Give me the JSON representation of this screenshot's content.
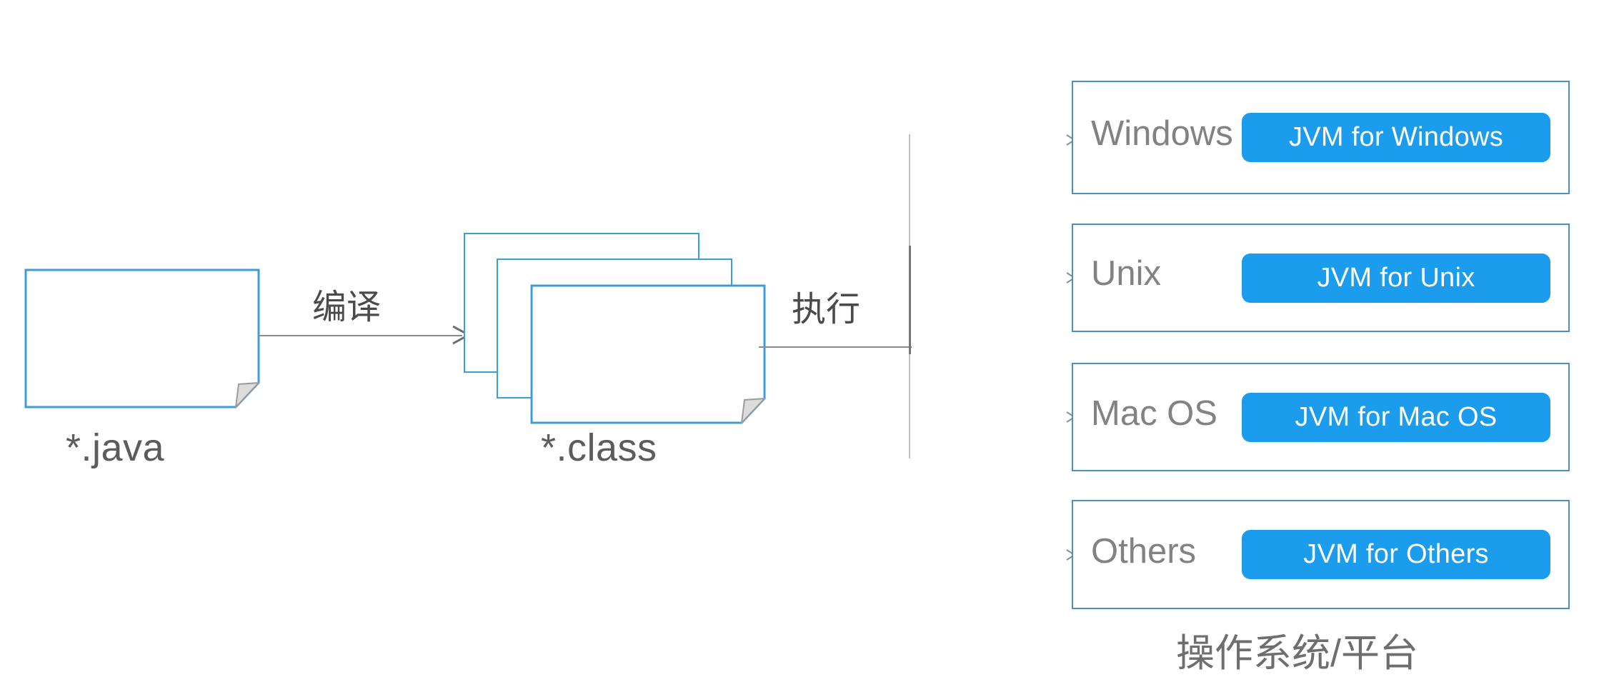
{
  "diagram": {
    "title": "Java compile and run cross-platform diagram",
    "colors": {
      "doc_border": "#3C9DD7",
      "os_box_border": "#4A90C4",
      "jvm_button": "#1B9CEC",
      "connector": "#8C8C8C",
      "text_gray": "#5C5C5C",
      "os_label_gray": "#828282"
    },
    "left": {
      "source_file_label": "*.java",
      "class_file_label": "*.class",
      "compile_edge_label": "编译",
      "execute_edge_label": "执行"
    },
    "right": {
      "platform_caption": "操作系统/平台",
      "rows": [
        {
          "os": "Windows",
          "jvm": "JVM for Windows"
        },
        {
          "os": "Unix",
          "jvm": "JVM for Unix"
        },
        {
          "os": "Mac OS",
          "jvm": "JVM for Mac OS"
        },
        {
          "os": "Others",
          "jvm": "JVM for Others"
        }
      ]
    }
  }
}
